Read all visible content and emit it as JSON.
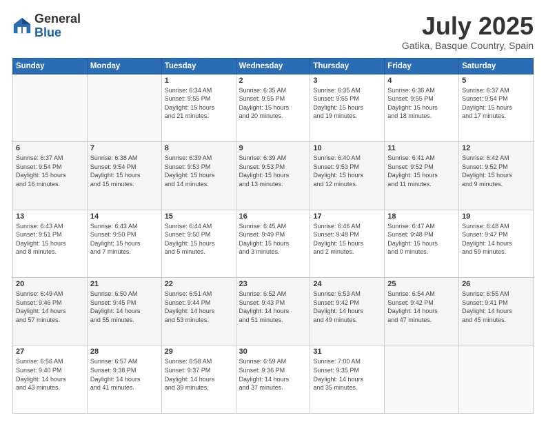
{
  "header": {
    "logo_general": "General",
    "logo_blue": "Blue",
    "month_title": "July 2025",
    "subtitle": "Gatika, Basque Country, Spain"
  },
  "days_of_week": [
    "Sunday",
    "Monday",
    "Tuesday",
    "Wednesday",
    "Thursday",
    "Friday",
    "Saturday"
  ],
  "weeks": [
    [
      {
        "num": "",
        "info": ""
      },
      {
        "num": "",
        "info": ""
      },
      {
        "num": "1",
        "info": "Sunrise: 6:34 AM\nSunset: 9:55 PM\nDaylight: 15 hours\nand 21 minutes."
      },
      {
        "num": "2",
        "info": "Sunrise: 6:35 AM\nSunset: 9:55 PM\nDaylight: 15 hours\nand 20 minutes."
      },
      {
        "num": "3",
        "info": "Sunrise: 6:35 AM\nSunset: 9:55 PM\nDaylight: 15 hours\nand 19 minutes."
      },
      {
        "num": "4",
        "info": "Sunrise: 6:36 AM\nSunset: 9:55 PM\nDaylight: 15 hours\nand 18 minutes."
      },
      {
        "num": "5",
        "info": "Sunrise: 6:37 AM\nSunset: 9:54 PM\nDaylight: 15 hours\nand 17 minutes."
      }
    ],
    [
      {
        "num": "6",
        "info": "Sunrise: 6:37 AM\nSunset: 9:54 PM\nDaylight: 15 hours\nand 16 minutes."
      },
      {
        "num": "7",
        "info": "Sunrise: 6:38 AM\nSunset: 9:54 PM\nDaylight: 15 hours\nand 15 minutes."
      },
      {
        "num": "8",
        "info": "Sunrise: 6:39 AM\nSunset: 9:53 PM\nDaylight: 15 hours\nand 14 minutes."
      },
      {
        "num": "9",
        "info": "Sunrise: 6:39 AM\nSunset: 9:53 PM\nDaylight: 15 hours\nand 13 minutes."
      },
      {
        "num": "10",
        "info": "Sunrise: 6:40 AM\nSunset: 9:53 PM\nDaylight: 15 hours\nand 12 minutes."
      },
      {
        "num": "11",
        "info": "Sunrise: 6:41 AM\nSunset: 9:52 PM\nDaylight: 15 hours\nand 11 minutes."
      },
      {
        "num": "12",
        "info": "Sunrise: 6:42 AM\nSunset: 9:52 PM\nDaylight: 15 hours\nand 9 minutes."
      }
    ],
    [
      {
        "num": "13",
        "info": "Sunrise: 6:43 AM\nSunset: 9:51 PM\nDaylight: 15 hours\nand 8 minutes."
      },
      {
        "num": "14",
        "info": "Sunrise: 6:43 AM\nSunset: 9:50 PM\nDaylight: 15 hours\nand 7 minutes."
      },
      {
        "num": "15",
        "info": "Sunrise: 6:44 AM\nSunset: 9:50 PM\nDaylight: 15 hours\nand 5 minutes."
      },
      {
        "num": "16",
        "info": "Sunrise: 6:45 AM\nSunset: 9:49 PM\nDaylight: 15 hours\nand 3 minutes."
      },
      {
        "num": "17",
        "info": "Sunrise: 6:46 AM\nSunset: 9:48 PM\nDaylight: 15 hours\nand 2 minutes."
      },
      {
        "num": "18",
        "info": "Sunrise: 6:47 AM\nSunset: 9:48 PM\nDaylight: 15 hours\nand 0 minutes."
      },
      {
        "num": "19",
        "info": "Sunrise: 6:48 AM\nSunset: 9:47 PM\nDaylight: 14 hours\nand 59 minutes."
      }
    ],
    [
      {
        "num": "20",
        "info": "Sunrise: 6:49 AM\nSunset: 9:46 PM\nDaylight: 14 hours\nand 57 minutes."
      },
      {
        "num": "21",
        "info": "Sunrise: 6:50 AM\nSunset: 9:45 PM\nDaylight: 14 hours\nand 55 minutes."
      },
      {
        "num": "22",
        "info": "Sunrise: 6:51 AM\nSunset: 9:44 PM\nDaylight: 14 hours\nand 53 minutes."
      },
      {
        "num": "23",
        "info": "Sunrise: 6:52 AM\nSunset: 9:43 PM\nDaylight: 14 hours\nand 51 minutes."
      },
      {
        "num": "24",
        "info": "Sunrise: 6:53 AM\nSunset: 9:42 PM\nDaylight: 14 hours\nand 49 minutes."
      },
      {
        "num": "25",
        "info": "Sunrise: 6:54 AM\nSunset: 9:42 PM\nDaylight: 14 hours\nand 47 minutes."
      },
      {
        "num": "26",
        "info": "Sunrise: 6:55 AM\nSunset: 9:41 PM\nDaylight: 14 hours\nand 45 minutes."
      }
    ],
    [
      {
        "num": "27",
        "info": "Sunrise: 6:56 AM\nSunset: 9:40 PM\nDaylight: 14 hours\nand 43 minutes."
      },
      {
        "num": "28",
        "info": "Sunrise: 6:57 AM\nSunset: 9:38 PM\nDaylight: 14 hours\nand 41 minutes."
      },
      {
        "num": "29",
        "info": "Sunrise: 6:58 AM\nSunset: 9:37 PM\nDaylight: 14 hours\nand 39 minutes."
      },
      {
        "num": "30",
        "info": "Sunrise: 6:59 AM\nSunset: 9:36 PM\nDaylight: 14 hours\nand 37 minutes."
      },
      {
        "num": "31",
        "info": "Sunrise: 7:00 AM\nSunset: 9:35 PM\nDaylight: 14 hours\nand 35 minutes."
      },
      {
        "num": "",
        "info": ""
      },
      {
        "num": "",
        "info": ""
      }
    ]
  ]
}
